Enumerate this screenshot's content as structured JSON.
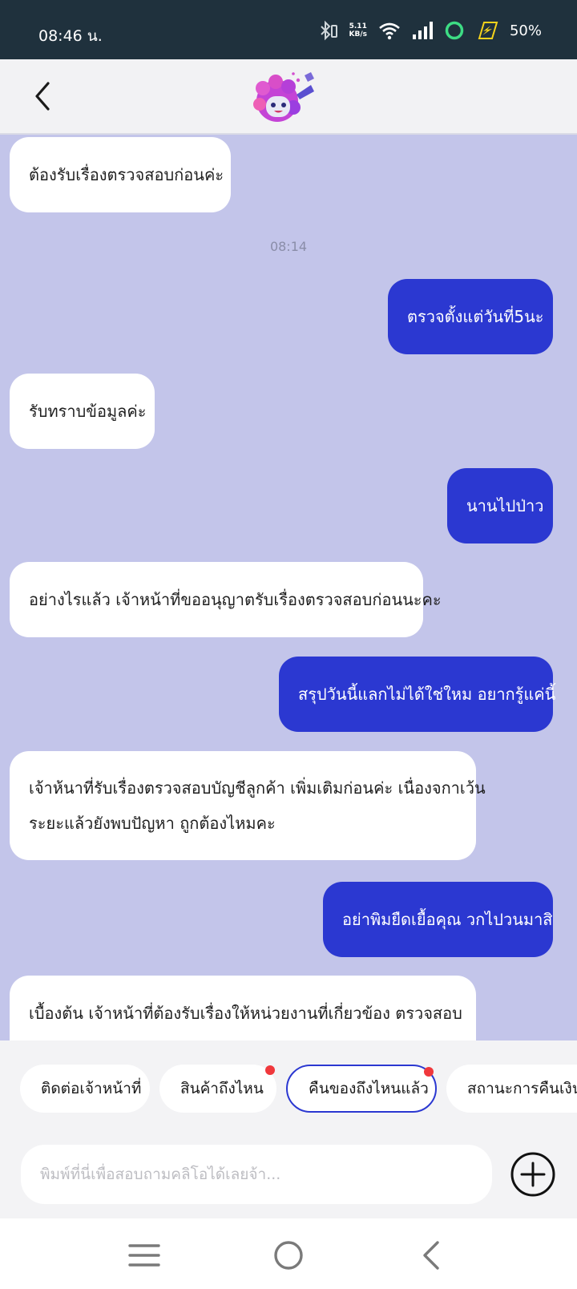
{
  "status_bar": {
    "time": "08:46 น.",
    "net_speed_value": "5.11",
    "net_speed_unit": "KB/s",
    "battery": "50%",
    "icons": [
      "bluetooth-icon",
      "wifi-icon",
      "signal-icon",
      "ring-icon",
      "charging-icon"
    ]
  },
  "header": {
    "back_icon": "chevron-left-icon",
    "logo": "mascot-logo"
  },
  "messages": [
    {
      "side": "in",
      "text": "ต้องรับเรื่องตรวจสอบก่อนค่ะ"
    },
    {
      "side": "time",
      "text": "08:14"
    },
    {
      "side": "out",
      "text": "ตรวจตั้งแต่วันที่5นะ"
    },
    {
      "side": "in",
      "text": "รับทราบข้อมูลค่ะ"
    },
    {
      "side": "out",
      "text": "นานไปป่าว"
    },
    {
      "side": "in",
      "text": "อย่างไรแล้ว เจ้าหน้าที่ขออนุญาตรับเรื่องตรวจสอบก่อนนะคะ"
    },
    {
      "side": "out",
      "text": "สรุปวันนี้แลกไม่ได้ใช่ใหม อยากรู้แค่นี้"
    },
    {
      "side": "in",
      "text": "เจ้าห้นาที่รับเรื่องตรวจสอบบัญชีลูกค้า เพิ่มเติมก่อนค่ะ   เนื่องจกาเว้น",
      "text2": "ระยะแล้วยังพบปัญหา ถูกต้องไหมคะ"
    },
    {
      "side": "out",
      "text": "อย่าพิมยืดเยื้อคุณ วกไปวนมาสิ"
    },
    {
      "side": "in",
      "text": "เบื้องต้น เจ้าหน้าที่ต้องรับเรื่องให้หน่วยงานที่เกี่ยวข้อง ตรวจสอบ"
    }
  ],
  "quick_replies": [
    {
      "label": "ติดต่อเจ้าหน้าที่",
      "badge": false,
      "active": false
    },
    {
      "label": "สินค้าถึงไหน",
      "badge": true,
      "active": false
    },
    {
      "label": "คืนของถึงไหนแล้ว",
      "badge": true,
      "active": true
    },
    {
      "label": "สถานะการคืนเงิน",
      "badge": false,
      "active": false
    }
  ],
  "composer": {
    "placeholder": "พิมพ์ที่นี่เพื่อสอบถามคลิโอได้เลยจ้า...",
    "add_icon": "plus-circle-icon"
  },
  "nav": [
    "menu-icon",
    "home-icon",
    "back-icon"
  ]
}
